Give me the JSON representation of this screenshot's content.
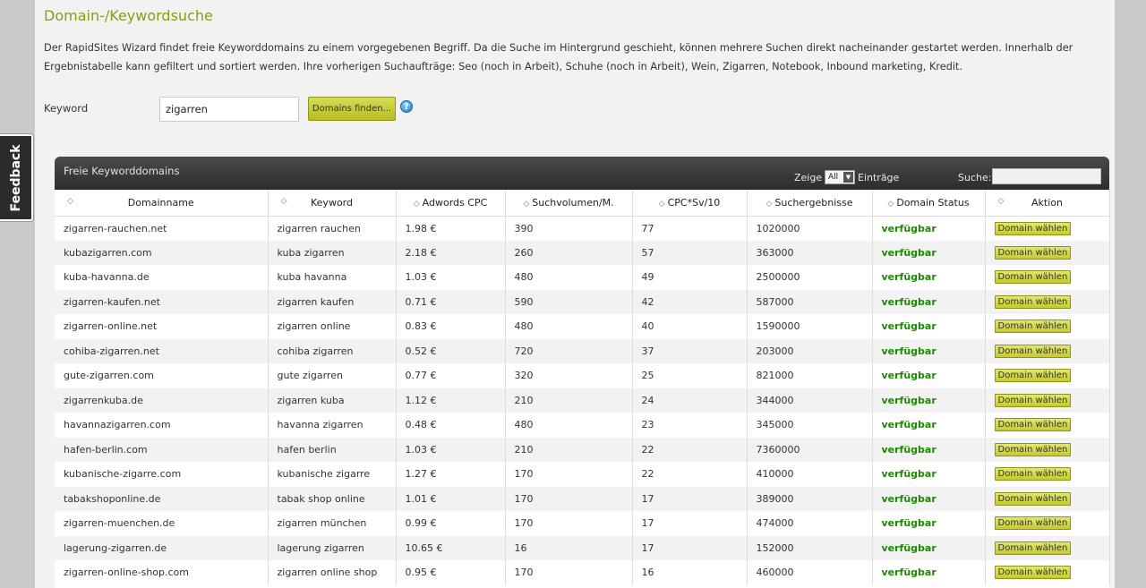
{
  "page": {
    "title": "Domain-/Keywordsuche",
    "intro": "Der RapidSites Wizard findet freie Keyworddomains zu einem vorgegebenen Begriff. Da die Suche im Hintergrund geschieht, können mehrere Suchen direkt nacheinander gestartet werden. Innerhalb der Ergebnistabelle kann gefiltert und sortiert werden. Ihre vorherigen Suchaufträge: Seo (noch in Arbeit), Schuhe (noch in Arbeit), Wein, Zigarren, Notebook, Inbound marketing, Kredit."
  },
  "search": {
    "label": "Keyword",
    "value": "zigarren",
    "button": "Domains finden...",
    "help_icon": "?"
  },
  "feedback": {
    "label": "Feedback"
  },
  "panel": {
    "title": "Freie Keyworddomains",
    "show_label": "Zeige",
    "show_value": "All",
    "entries_label": "Einträge",
    "search_label": "Suche:",
    "search_value": ""
  },
  "table": {
    "headers": [
      "Domainname",
      "Keyword",
      "Adwords CPC",
      "Suchvolumen/M.",
      "CPC*Sv/10",
      "Suchergebnisse",
      "Domain Status",
      "Aktion"
    ],
    "rows": [
      {
        "domain": "zigarren-rauchen.net",
        "keyword": "zigarren rauchen",
        "cpc": "1.98 €",
        "volume": "390",
        "cpcsv": "77",
        "results": "1020000",
        "status": "verfügbar",
        "action": "Domain wählen"
      },
      {
        "domain": "kubazigarren.com",
        "keyword": "kuba zigarren",
        "cpc": "2.18 €",
        "volume": "260",
        "cpcsv": "57",
        "results": "363000",
        "status": "verfügbar",
        "action": "Domain wählen"
      },
      {
        "domain": "kuba-havanna.de",
        "keyword": "kuba havanna",
        "cpc": "1.03 €",
        "volume": "480",
        "cpcsv": "49",
        "results": "2500000",
        "status": "verfügbar",
        "action": "Domain wählen"
      },
      {
        "domain": "zigarren-kaufen.net",
        "keyword": "zigarren kaufen",
        "cpc": "0.71 €",
        "volume": "590",
        "cpcsv": "42",
        "results": "587000",
        "status": "verfügbar",
        "action": "Domain wählen"
      },
      {
        "domain": "zigarren-online.net",
        "keyword": "zigarren online",
        "cpc": "0.83 €",
        "volume": "480",
        "cpcsv": "40",
        "results": "1590000",
        "status": "verfügbar",
        "action": "Domain wählen"
      },
      {
        "domain": "cohiba-zigarren.net",
        "keyword": "cohiba zigarren",
        "cpc": "0.52 €",
        "volume": "720",
        "cpcsv": "37",
        "results": "203000",
        "status": "verfügbar",
        "action": "Domain wählen"
      },
      {
        "domain": "gute-zigarren.com",
        "keyword": "gute zigarren",
        "cpc": "0.77 €",
        "volume": "320",
        "cpcsv": "25",
        "results": "821000",
        "status": "verfügbar",
        "action": "Domain wählen"
      },
      {
        "domain": "zigarrenkuba.de",
        "keyword": "zigarren kuba",
        "cpc": "1.12 €",
        "volume": "210",
        "cpcsv": "24",
        "results": "344000",
        "status": "verfügbar",
        "action": "Domain wählen"
      },
      {
        "domain": "havannazigarren.com",
        "keyword": "havanna zigarren",
        "cpc": "0.48 €",
        "volume": "480",
        "cpcsv": "23",
        "results": "345000",
        "status": "verfügbar",
        "action": "Domain wählen"
      },
      {
        "domain": "hafen-berlin.com",
        "keyword": "hafen berlin",
        "cpc": "1.03 €",
        "volume": "210",
        "cpcsv": "22",
        "results": "7360000",
        "status": "verfügbar",
        "action": "Domain wählen"
      },
      {
        "domain": "kubanische-zigarre.com",
        "keyword": "kubanische zigarre",
        "cpc": "1.27 €",
        "volume": "170",
        "cpcsv": "22",
        "results": "410000",
        "status": "verfügbar",
        "action": "Domain wählen"
      },
      {
        "domain": "tabakshoponline.de",
        "keyword": "tabak shop online",
        "cpc": "1.01 €",
        "volume": "170",
        "cpcsv": "17",
        "results": "389000",
        "status": "verfügbar",
        "action": "Domain wählen"
      },
      {
        "domain": "zigarren-muenchen.de",
        "keyword": "zigarren münchen",
        "cpc": "0.99 €",
        "volume": "170",
        "cpcsv": "17",
        "results": "474000",
        "status": "verfügbar",
        "action": "Domain wählen"
      },
      {
        "domain": "lagerung-zigarren.de",
        "keyword": "lagerung zigarren",
        "cpc": "10.65 €",
        "volume": "16",
        "cpcsv": "17",
        "results": "152000",
        "status": "verfügbar",
        "action": "Domain wählen"
      },
      {
        "domain": "zigarren-online-shop.com",
        "keyword": "zigarren online shop",
        "cpc": "0.95 €",
        "volume": "170",
        "cpcsv": "16",
        "results": "460000",
        "status": "verfügbar",
        "action": "Domain wählen"
      }
    ]
  },
  "colors": {
    "accent": "#8a9a1a",
    "status_green": "#1a8a00",
    "button": "#c5ca2f",
    "panel_header": "#2c2c2c"
  }
}
